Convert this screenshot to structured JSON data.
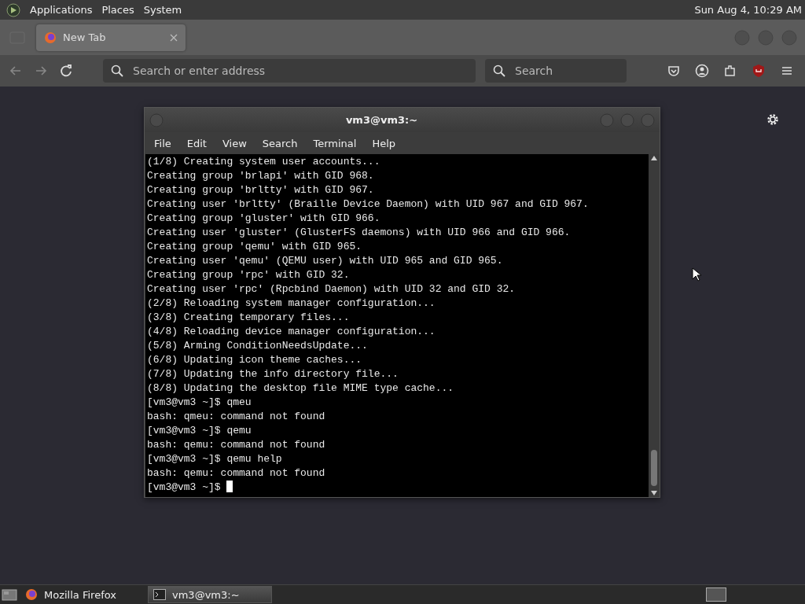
{
  "top_panel": {
    "menus": [
      "Applications",
      "Places",
      "System"
    ],
    "clock": "Sun Aug  4, 10:29 AM"
  },
  "browser": {
    "tabs": [
      {
        "label": "New Tab",
        "selected": true
      }
    ],
    "address_placeholder": "Search or enter address",
    "search_placeholder": "Search"
  },
  "terminal": {
    "title": "vm3@vm3:~",
    "menu": [
      "File",
      "Edit",
      "View",
      "Search",
      "Terminal",
      "Help"
    ],
    "lines": [
      "(1/8) Creating system user accounts...",
      "Creating group 'brlapi' with GID 968.",
      "Creating group 'brltty' with GID 967.",
      "Creating user 'brltty' (Braille Device Daemon) with UID 967 and GID 967.",
      "Creating group 'gluster' with GID 966.",
      "Creating user 'gluster' (GlusterFS daemons) with UID 966 and GID 966.",
      "Creating group 'qemu' with GID 965.",
      "Creating user 'qemu' (QEMU user) with UID 965 and GID 965.",
      "Creating group 'rpc' with GID 32.",
      "Creating user 'rpc' (Rpcbind Daemon) with UID 32 and GID 32.",
      "(2/8) Reloading system manager configuration...",
      "(3/8) Creating temporary files...",
      "(4/8) Reloading device manager configuration...",
      "(5/8) Arming ConditionNeedsUpdate...",
      "(6/8) Updating icon theme caches...",
      "(7/8) Updating the info directory file...",
      "(8/8) Updating the desktop file MIME type cache...",
      "[vm3@vm3 ~]$ qmeu",
      "bash: qmeu: command not found",
      "[vm3@vm3 ~]$ qemu",
      "bash: qemu: command not found",
      "[vm3@vm3 ~]$ qemu help",
      "bash: qemu: command not found",
      "[vm3@vm3 ~]$ "
    ]
  },
  "taskbar": {
    "items": [
      {
        "label": "Mozilla Firefox",
        "selected": false
      },
      {
        "label": "vm3@vm3:~",
        "selected": true
      }
    ]
  }
}
